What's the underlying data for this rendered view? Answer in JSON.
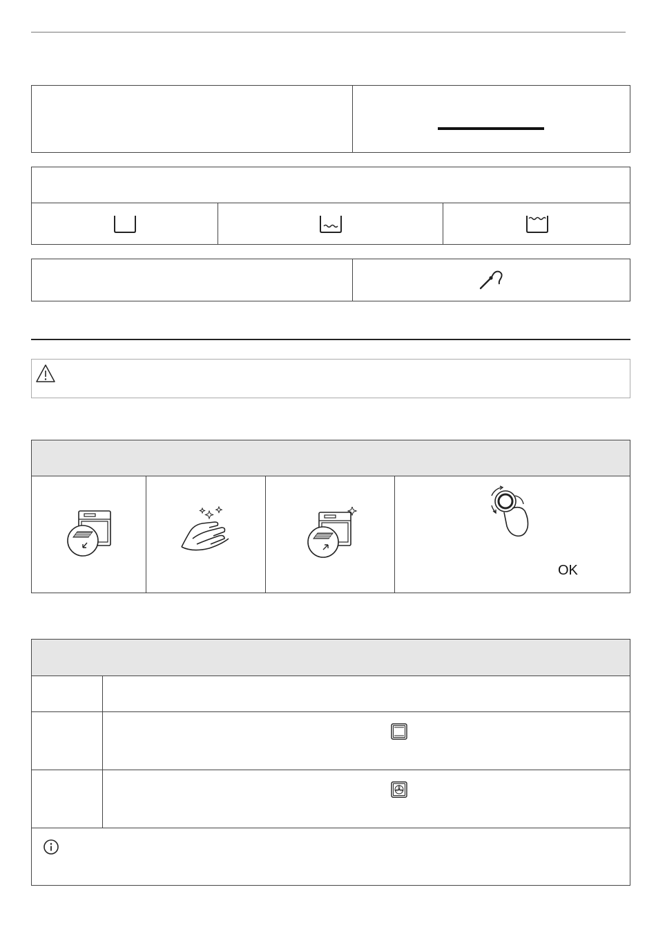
{
  "page": {
    "step_control": {
      "confirm_label": "OK"
    }
  },
  "icons": {
    "container_empty": "container-empty-icon",
    "container_low_water": "container-low-water-icon",
    "container_full_water": "container-full-water-icon",
    "steam_tube": "steam-tube-icon",
    "warning": "warning-triangle-icon",
    "remove_tray": "remove-tray-icon",
    "clean_hands": "clean-hands-icon",
    "insert_tray": "insert-tray-icon",
    "knob_turn": "knob-turn-hand-icon",
    "conventional_heating": "conventional-heating-icon",
    "fan_heating": "fan-heating-icon",
    "info": "info-icon"
  }
}
